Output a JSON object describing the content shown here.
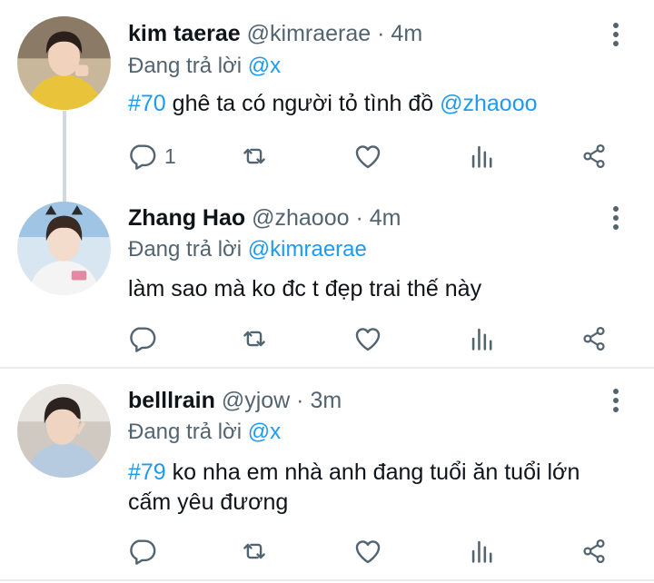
{
  "tweets": [
    {
      "name": "kim taerae",
      "handle": "@kimraerae",
      "time": "4m",
      "reply_prefix": "Đang trả lời",
      "reply_to": "@x",
      "hashtag": "#70",
      "text": "ghê ta có người tỏ tình đồ",
      "mention": "@zhaooo",
      "reply_count": "1"
    },
    {
      "name": "Zhang Hao",
      "handle": "@zhaooo",
      "time": "4m",
      "reply_prefix": "Đang trả lời",
      "reply_to": "@kimraerae",
      "text": "làm sao mà ko đc t đẹp trai thế này"
    },
    {
      "name": "belllrain",
      "handle": "@yjow",
      "time": "3m",
      "reply_prefix": "Đang trả lời",
      "reply_to": "@x",
      "hashtag": "#79",
      "text": "ko nha em nhà anh đang tuổi ăn tuổi lớn cấm yêu đương"
    }
  ],
  "separator": "·",
  "icons": [
    "reply-icon",
    "retweet-icon",
    "like-icon",
    "stats-icon",
    "share-icon",
    "more-icon"
  ],
  "colors": {
    "accent": "#1d9bf0",
    "muted": "#536471",
    "text": "#0f1419"
  }
}
